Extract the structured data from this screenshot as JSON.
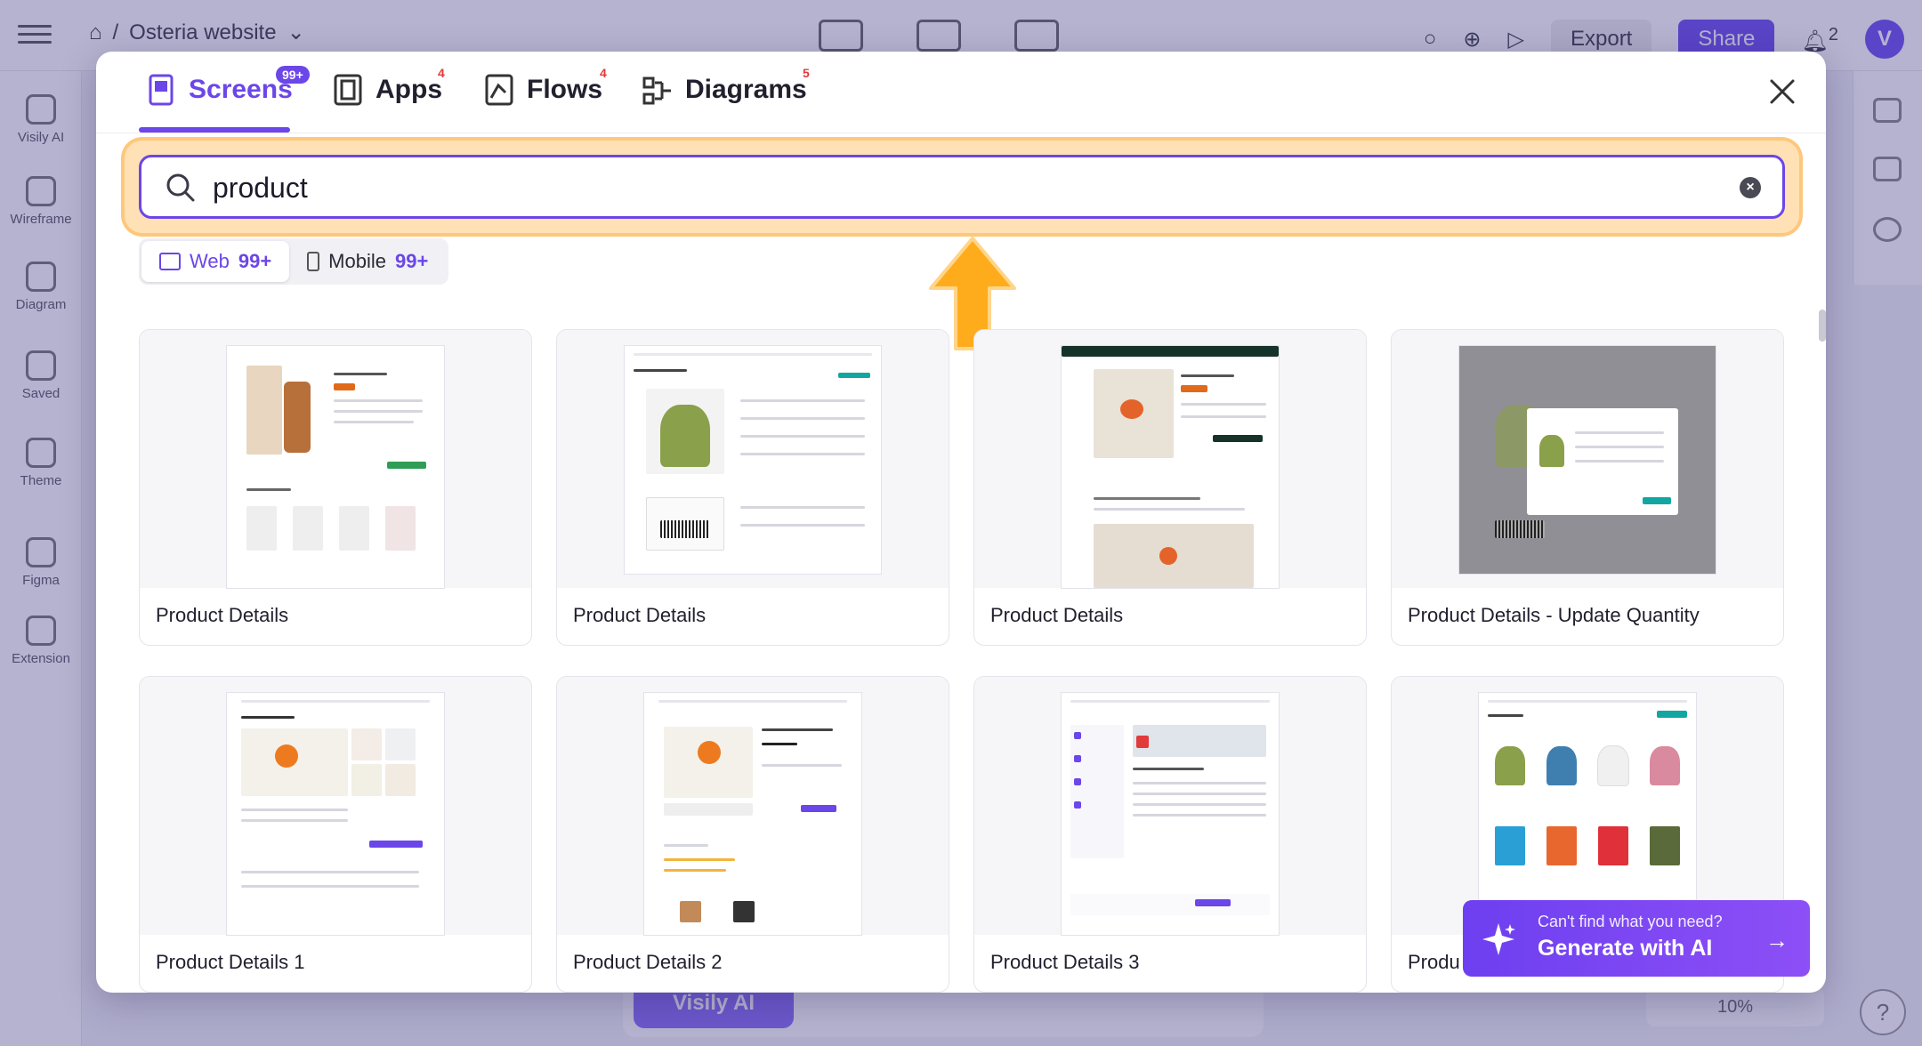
{
  "app": {
    "project_name": "Osteria website",
    "export_label": "Export",
    "share_label": "Share",
    "avatar_letter": "V",
    "notifications_count": "2",
    "zoom": "10%",
    "visily_ai_label": "Visily AI",
    "sidebar": [
      {
        "label": "Visily AI"
      },
      {
        "label": "Wireframe"
      },
      {
        "label": "Diagram"
      },
      {
        "label": "Saved"
      },
      {
        "label": "Theme"
      },
      {
        "label": "Figma"
      },
      {
        "label": "Extension"
      }
    ]
  },
  "modal": {
    "tabs": [
      {
        "label": "Screens",
        "badge": "99+"
      },
      {
        "label": "Apps",
        "badge": "4"
      },
      {
        "label": "Flows",
        "badge": "4"
      },
      {
        "label": "Diagrams",
        "badge": "5"
      }
    ],
    "search": {
      "value": "product"
    },
    "platforms": [
      {
        "label": "Web",
        "count": "99+"
      },
      {
        "label": "Mobile",
        "count": "99+"
      }
    ],
    "cards": [
      {
        "label": "Product Details"
      },
      {
        "label": "Product Details"
      },
      {
        "label": "Product Details"
      },
      {
        "label": "Product Details - Update Quantity"
      },
      {
        "label": "Product Details 1"
      },
      {
        "label": "Product Details 2"
      },
      {
        "label": "Product Details 3"
      },
      {
        "label": "Produ"
      }
    ],
    "ai_banner": {
      "subtitle": "Can't find what you need?",
      "title": "Generate with AI"
    }
  },
  "colors": {
    "accent": "#6b46e8",
    "highlight": "#ffb13b",
    "badge_red": "#e03a3a"
  }
}
